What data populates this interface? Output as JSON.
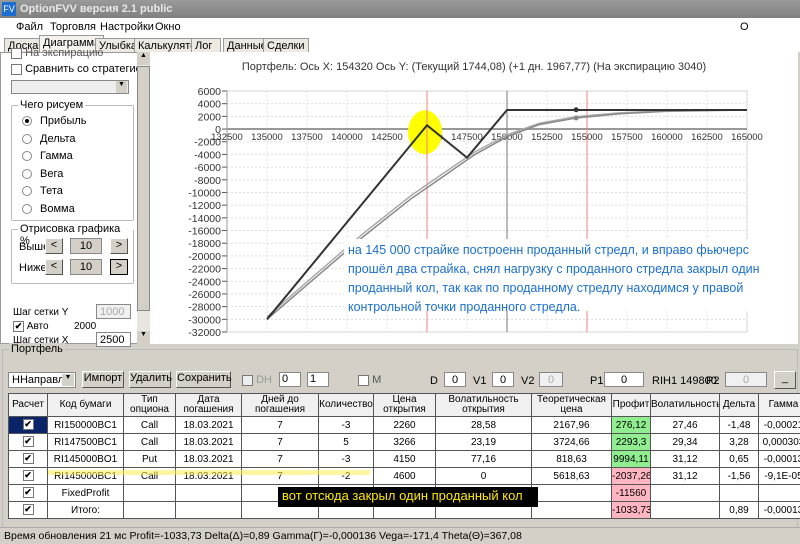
{
  "window": {
    "title": "OptionFVV версия 2.1 public",
    "icon": "FV"
  },
  "menu": [
    "Файл",
    "Торговля",
    "Настройки",
    "Окно"
  ],
  "menu_right": "О программе",
  "tabs": [
    "Доска",
    "Диаграмма",
    "Улыбка",
    "Калькулятор",
    "Лог",
    "Данные",
    "Сделки"
  ],
  "left": {
    "expiry_label": "На экспирацию",
    "compare": "Сравнить со стратегией",
    "what_title": "Чего рисуем",
    "radios": [
      "Прибыль",
      "Дельта",
      "Гамма",
      "Вега",
      "Тета",
      "Вомма"
    ],
    "draw_title": "Отрисовка графика %",
    "above": "Выше",
    "below": "Ниже",
    "above_val": "10",
    "below_val": "10",
    "prev": "<",
    "next": ">",
    "grid_y": "Шаг сетки Y",
    "grid_y_val": "1000",
    "auto": "Авто",
    "auto_val": "2000",
    "grid_x": "Шаг сетки X",
    "grid_x_val": "2500"
  },
  "chart_data": {
    "type": "line",
    "title": "Портфель: Ось X: 154320 Ось Y:  (Текущий 1744,08)  (+1 дн. 1967,77)  (На экспирацию 3040)",
    "xlim": [
      132500,
      165000
    ],
    "ylim": [
      -32000,
      6000
    ],
    "xticks": [
      132500,
      135000,
      137500,
      140000,
      142500,
      145000,
      147500,
      150000,
      152500,
      155000,
      157500,
      160000,
      162500,
      165000
    ],
    "yticks": [
      6000,
      4000,
      2000,
      0,
      -2000,
      -4000,
      -6000,
      -8000,
      -10000,
      -12000,
      -14000,
      -16000,
      -18000,
      -20000,
      -22000,
      -24000,
      -26000,
      -28000,
      -30000,
      -32000
    ],
    "series": [
      {
        "name": "На экспирацию",
        "color": "#333333",
        "x": [
          135000,
          145000,
          147500,
          150000,
          165000
        ],
        "y": [
          -30000,
          600,
          -4500,
          3000,
          3000
        ]
      },
      {
        "name": "Текущий",
        "color": "#888888",
        "x": [
          135000,
          138000,
          141000,
          144000,
          146000,
          148000,
          150000,
          152000,
          154320,
          157000,
          160000,
          165000
        ],
        "y": [
          -30000,
          -23500,
          -17000,
          -11000,
          -7500,
          -4000,
          -1200,
          700,
          1744,
          2400,
          2800,
          3000
        ]
      },
      {
        "name": "+1 дн.",
        "color": "#aaaaaa",
        "x": [
          135000,
          138000,
          141000,
          144000,
          146000,
          148000,
          150000,
          152000,
          154320,
          157000,
          160000,
          165000
        ],
        "y": [
          -29600,
          -23000,
          -16500,
          -10500,
          -7000,
          -3600,
          -900,
          900,
          1968,
          2550,
          2880,
          3010
        ]
      }
    ],
    "vlines": [
      {
        "x": 145000,
        "color": "#f08080"
      },
      {
        "x": 150000,
        "color": "#777777"
      },
      {
        "x": 155000,
        "color": "#f08080"
      }
    ],
    "markers": [
      {
        "x": 154320,
        "y": 3040
      },
      {
        "x": 154320,
        "y": 1744
      }
    ]
  },
  "annotation": "на 145 000 страйке построенн проданный стредл, и вправо фьючерс прошёл два страйка, снял нагрузку с проданного стредла закрыл один проданный кол, так как по проданному стредлу находимся у правой контрольной точки проданного стредла.",
  "portfolio": {
    "title": "Портфель",
    "select": "ННаправле",
    "import": "Импорт",
    "delete": "Удалить",
    "save": "Сохранить",
    "dh": "DH",
    "spin1": "0",
    "spin2": "1",
    "m": "M",
    "d_label": "D",
    "d": "0",
    "v1_label": "V1",
    "v1": "0",
    "v2_label": "V2",
    "v2": "0",
    "p1_label": "P1",
    "p1": "0",
    "rih": "RIH1 149800",
    "p2_label": "P2",
    "p2": "0",
    "min_btn": "_"
  },
  "table": {
    "headers": [
      "Расчет",
      "Код бумаги",
      "Тип опциона",
      "Дата погашения",
      "Дней до погашения",
      "Количество",
      "Цена открытия",
      "Волатильность открытия",
      "Теоретическая цена",
      "Профит",
      "Волатильность",
      "Дельта",
      "Гамма"
    ],
    "rows": [
      [
        "✔",
        "RI150000BC1",
        "Call",
        "18.03.2021",
        "7",
        "-3",
        "2260",
        "28,58",
        "2167,96",
        "276,12",
        "27,46",
        "-1,48",
        "-0,00021"
      ],
      [
        "✔",
        "RI147500BC1",
        "Call",
        "18.03.2021",
        "7",
        "5",
        "3266",
        "23,19",
        "3724,66",
        "2293,3",
        "29,34",
        "3,28",
        "0,000303"
      ],
      [
        "✔",
        "RI145000BO1",
        "Put",
        "18.03.2021",
        "7",
        "-3",
        "4150",
        "77,16",
        "818,63",
        "9994,11",
        "31,12",
        "0,65",
        "-0,00013"
      ],
      [
        "✔",
        "RI145000BC1",
        "Call",
        "18.03.2021",
        "7",
        "-2",
        "4600",
        "0",
        "5618,63",
        "-2037,26",
        "31,12",
        "-1,56",
        "-9,1E-05"
      ],
      [
        "✔",
        "FixedProfit",
        "",
        "",
        "",
        "",
        "",
        "",
        "",
        "-11560",
        "",
        "",
        ""
      ],
      [
        "✔",
        "Итого:",
        "",
        "",
        "",
        "",
        "",
        "",
        "",
        "-1033,73",
        "",
        "0,89",
        "-0,00013"
      ]
    ]
  },
  "callout": "вот отсюда закрыл один проданный кол",
  "status": "Время обновления 21 мс  Profit=-1033,73 Delta(Δ)=0,89 Gamma(Γ)=-0,000136 Vega=-171,4 Theta(Θ)=367,08"
}
